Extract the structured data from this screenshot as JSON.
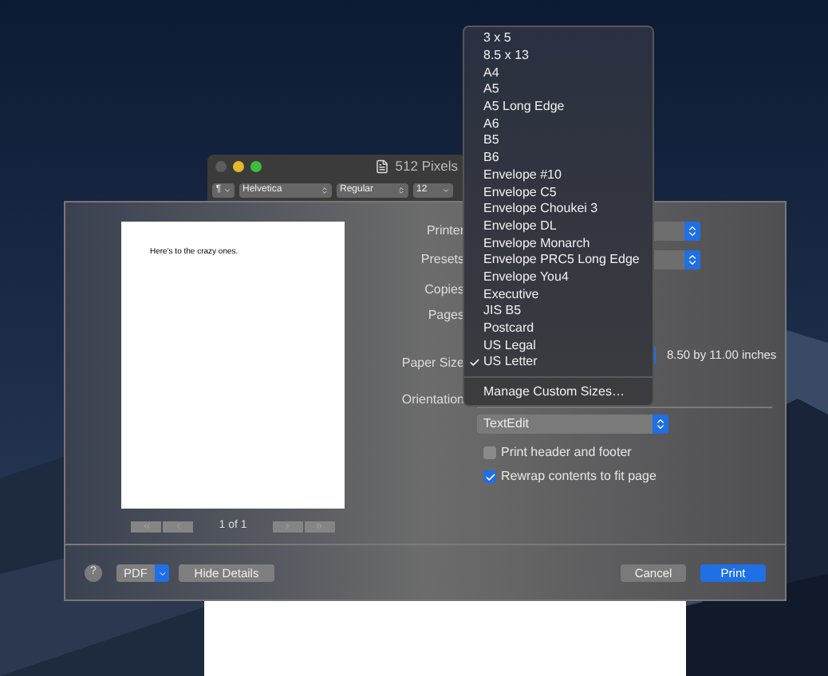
{
  "window": {
    "title": "512 Pixels"
  },
  "toolbar": {
    "paragraph": "¶",
    "font": "Helvetica",
    "style": "Regular",
    "size": "12"
  },
  "preview": {
    "text": "Here's to the crazy ones.",
    "pager": "1 of 1"
  },
  "settings": {
    "printer": "Printer",
    "presets": "Presets",
    "copies": "Copies",
    "pages": "Pages",
    "paper_size": "Paper Size",
    "paper_info": "8.50 by 11.00 inches",
    "orientation": "Orientation"
  },
  "app_menu": {
    "value": "TextEdit"
  },
  "options": [
    {
      "label": "Print header and footer",
      "checked": false
    },
    {
      "label": "Rewrap contents to fit page",
      "checked": true
    }
  ],
  "paper_menu": {
    "items": [
      {
        "label": "3 x 5",
        "selected": false
      },
      {
        "label": "8.5 x 13",
        "selected": false
      },
      {
        "label": "A4",
        "selected": false
      },
      {
        "label": "A5",
        "selected": false
      },
      {
        "label": "A5 Long Edge",
        "selected": false
      },
      {
        "label": "A6",
        "selected": false
      },
      {
        "label": "B5",
        "selected": false
      },
      {
        "label": "B6",
        "selected": false
      },
      {
        "label": "Envelope #10",
        "selected": false
      },
      {
        "label": "Envelope C5",
        "selected": false
      },
      {
        "label": "Envelope Choukei 3",
        "selected": false
      },
      {
        "label": "Envelope DL",
        "selected": false
      },
      {
        "label": "Envelope Monarch",
        "selected": false
      },
      {
        "label": "Envelope PRC5 Long Edge",
        "selected": false
      },
      {
        "label": "Envelope You4",
        "selected": false
      },
      {
        "label": "Executive",
        "selected": false
      },
      {
        "label": "JIS B5",
        "selected": false
      },
      {
        "label": "Postcard",
        "selected": false
      },
      {
        "label": "US Legal",
        "selected": false
      },
      {
        "label": "US Letter",
        "selected": true
      }
    ],
    "footer": "Manage Custom Sizes…"
  },
  "buttons": {
    "help": "?",
    "pdf": "PDF",
    "details": "Hide Details",
    "cancel": "Cancel",
    "print": "Print"
  }
}
